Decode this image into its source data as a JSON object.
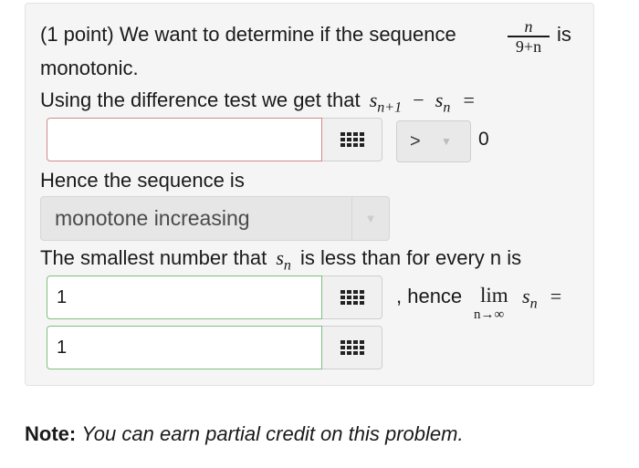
{
  "problem": {
    "intro_text": "(1 point) We want to determine if the sequence",
    "fraction": {
      "numerator": "n",
      "denominator": "9+n"
    },
    "intro_after": "is",
    "intro_line2": "monotonic.",
    "difference_text": "Using the difference test we get that",
    "difference_expr": {
      "s1": "s",
      "sub1": "n+1",
      "minus": "−",
      "s2": "s",
      "sub2": "n",
      "equals": "="
    },
    "answer1": {
      "value": ""
    },
    "comparison": {
      "selected": ">",
      "rhs": "0"
    },
    "hence_text": "Hence the sequence is",
    "sequence_select": {
      "selected": "monotone increasing"
    },
    "bound_text_a": "The smallest number that",
    "bound_var": {
      "s": "s",
      "sub": "n"
    },
    "bound_text_b": "is less than for every n is",
    "answer2": {
      "value": "1"
    },
    "hence_limit": ", hence",
    "limit": {
      "lim": "lim",
      "sub": "n→∞",
      "s": "s",
      "s_sub": "n",
      "equals": "="
    },
    "answer3": {
      "value": "1"
    }
  },
  "note": {
    "label": "Note:",
    "text": "You can earn partial credit on this problem."
  }
}
